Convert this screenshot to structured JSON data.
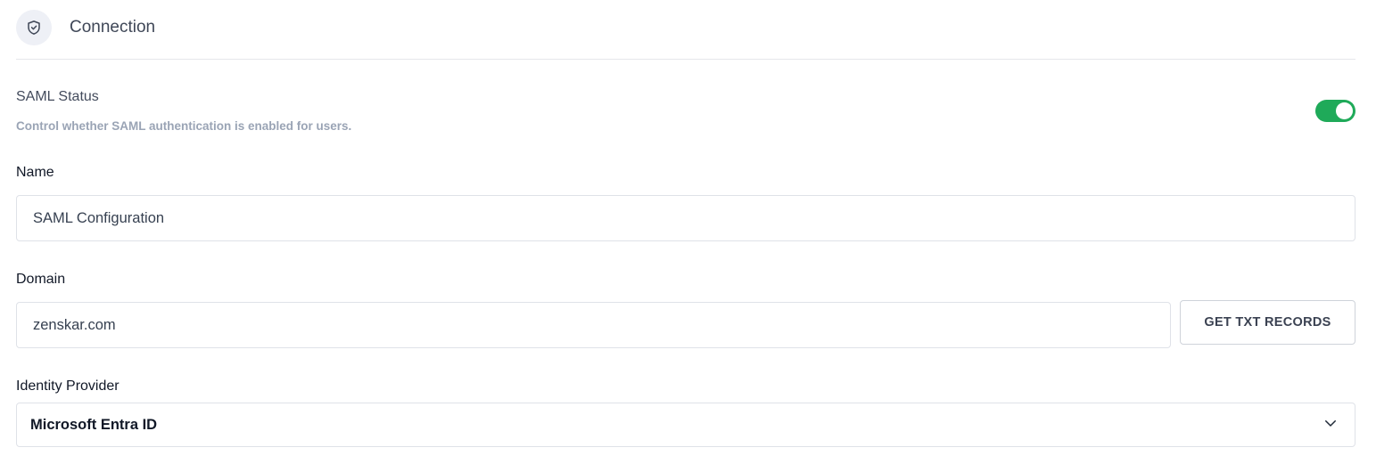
{
  "header": {
    "title": "Connection",
    "icon": "shield-check-icon"
  },
  "saml_status": {
    "label": "SAML Status",
    "description": "Control whether SAML authentication is enabled for users.",
    "enabled": true,
    "toggle_color": "#1faa59"
  },
  "name_field": {
    "label": "Name",
    "value": "SAML Configuration"
  },
  "domain_field": {
    "label": "Domain",
    "value": "zenskar.com",
    "button_label": "GET TXT RECORDS"
  },
  "identity_provider": {
    "label": "Identity Provider",
    "selected": "Microsoft Entra ID",
    "icon": "chevron-down-icon"
  }
}
